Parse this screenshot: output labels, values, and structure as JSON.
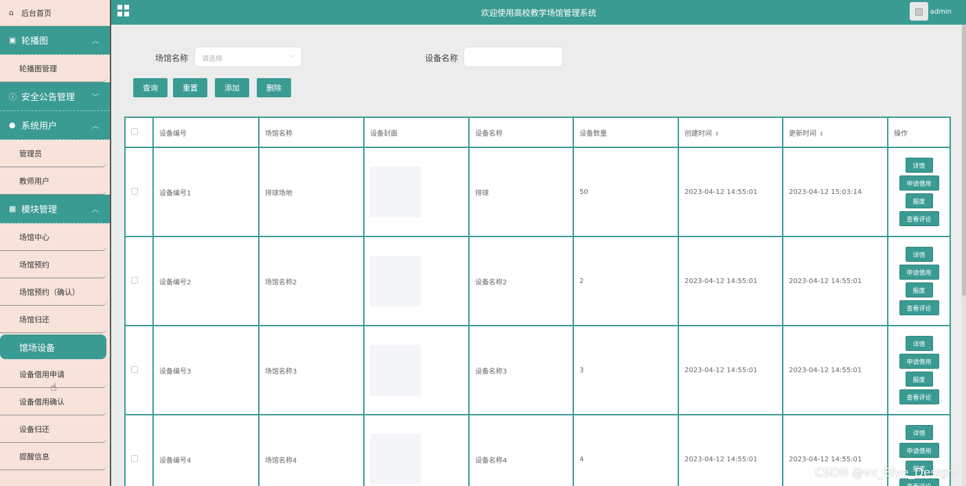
{
  "sidebar": {
    "home": "后台首页",
    "groups": [
      {
        "label": "轮播图",
        "items": [
          "轮播图管理"
        ]
      },
      {
        "label": "安全公告管理",
        "items": []
      },
      {
        "label": "系统用户",
        "items": [
          "管理员",
          "教师用户"
        ]
      },
      {
        "label": "模块管理",
        "items": [
          "场馆中心",
          "场馆预约",
          "场馆预约（确认）",
          "场馆归还",
          "馆场设备",
          "设备借用申请",
          "设备借用确认",
          "设备归还",
          "提醒信息"
        ]
      }
    ],
    "active_item": "馆场设备"
  },
  "header": {
    "title": "欢迎使用高校教学场馆管理系统",
    "user": "admin"
  },
  "search": {
    "venue_label": "场馆名称",
    "venue_placeholder": "请选择",
    "equipment_label": "设备名称",
    "equipment_value": ""
  },
  "buttons": {
    "query": "查询",
    "reset": "重置",
    "add": "添加",
    "delete": "删除"
  },
  "table": {
    "headers": [
      "设备编号",
      "场馆名称",
      "设备封面",
      "设备名称",
      "设备数量",
      "创建时间",
      "更新时间",
      "操作"
    ],
    "rows": [
      {
        "code": "设备编号1",
        "venue": "排球场地",
        "name": "排球",
        "qty": "50",
        "created": "2023-04-12 14:55:01",
        "updated": "2023-04-12 15:03:14"
      },
      {
        "code": "设备编号2",
        "venue": "场馆名称2",
        "name": "设备名称2",
        "qty": "2",
        "created": "2023-04-12 14:55:01",
        "updated": "2023-04-12 14:55:01"
      },
      {
        "code": "设备编号3",
        "venue": "场馆名称3",
        "name": "设备名称3",
        "qty": "3",
        "created": "2023-04-12 14:55:01",
        "updated": "2023-04-12 14:55:01"
      },
      {
        "code": "设备编号4",
        "venue": "场馆名称4",
        "name": "设备名称4",
        "qty": "4",
        "created": "2023-04-12 14:55:01",
        "updated": "2023-04-12 14:55:01"
      }
    ],
    "actions": [
      "详情",
      "申请借用",
      "报废",
      "查看评论"
    ]
  },
  "watermark": "CSDN @vx_Biye_Design",
  "colors": {
    "primary": "#3a9b93",
    "sidebar_bg": "#f7e3da"
  }
}
